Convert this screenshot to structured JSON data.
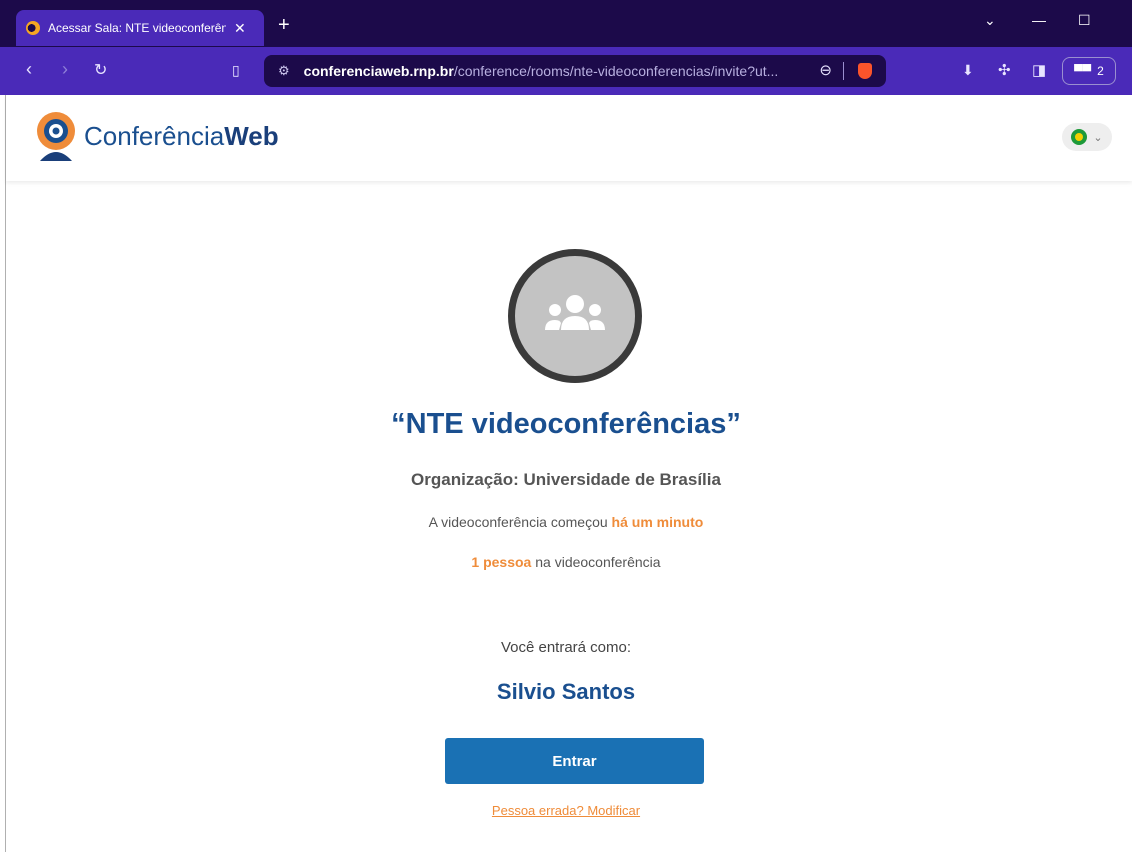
{
  "browser": {
    "tab": {
      "title": "Acessar Sala: NTE videoconferên",
      "close": "✕"
    },
    "new_tab": "+",
    "window_controls": [
      "⌄",
      "—",
      "☐"
    ],
    "url": {
      "host": "conferenciaweb.rnp.br",
      "path": "/conference/rooms/nte-videoconferencias/invite?ut..."
    },
    "extension_badge": "2"
  },
  "site": {
    "logo": {
      "text_regular": "Conferência",
      "text_bold": "Web"
    },
    "language_icon": "brazil-flag-icon"
  },
  "room": {
    "title": "“NTE videoconferências”",
    "organization": "Organização: Universidade de Brasília",
    "started_prefix": "A videoconferência começou ",
    "started_time": "há um minuto",
    "people_count": "1 pessoa",
    "people_suffix": " na videoconferência"
  },
  "join": {
    "enter_as_label": "Você entrará como:",
    "user_name": "Silvio Santos",
    "enter_button": "Entrar",
    "wrong_person_link": "Pessoa errada? Modificar"
  },
  "colors": {
    "brand_blue": "#1a4f8f",
    "button_blue": "#1a71b4",
    "accent_orange": "#ef8c3a",
    "browser_purple": "#4a2ab8"
  }
}
